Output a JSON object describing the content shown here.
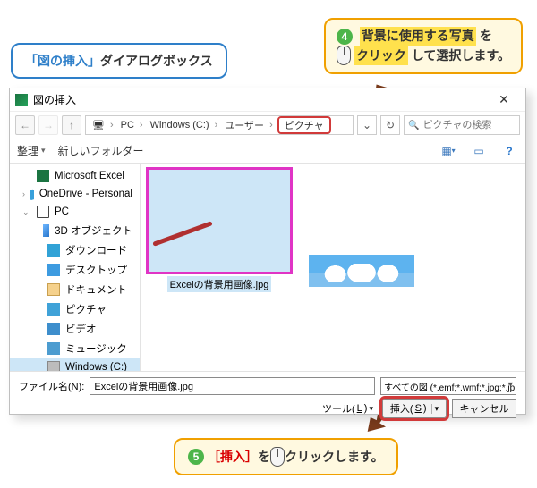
{
  "callouts": {
    "topLeft": {
      "blue": "「図の挿入」",
      "rest": "ダイアログボックス"
    },
    "topRight": {
      "step": "4",
      "line1a": "背景に使用する写真",
      "line1b": "を",
      "line2a": "クリック",
      "line2b": "して選択します。"
    },
    "bottom": {
      "step": "5",
      "hl": "［挿入］",
      "mid": " を ",
      "click": "クリック",
      "end": "します。"
    }
  },
  "dialog": {
    "title": "図の挿入",
    "breadcrumb": [
      "PC",
      "Windows (C:)",
      "ユーザー"
    ],
    "breadcrumbCurrent": "ピクチャ",
    "searchPlaceholder": "ピクチャの検索",
    "toolbar": {
      "organize": "整理",
      "newFolder": "新しいフォルダー"
    },
    "sidebar": [
      {
        "label": "Microsoft Excel",
        "ico": "ico-excel",
        "exp": " "
      },
      {
        "label": "OneDrive - Personal",
        "ico": "ico-cloud",
        "exp": "›"
      },
      {
        "label": "PC",
        "ico": "ico-pc",
        "exp": "⌄"
      },
      {
        "label": "3D オブジェクト",
        "ico": "ico-3d",
        "exp": " ",
        "indent": true
      },
      {
        "label": "ダウンロード",
        "ico": "ico-dl",
        "exp": " ",
        "indent": true
      },
      {
        "label": "デスクトップ",
        "ico": "ico-desk",
        "exp": " ",
        "indent": true
      },
      {
        "label": "ドキュメント",
        "ico": "ico-doc",
        "exp": " ",
        "indent": true
      },
      {
        "label": "ピクチャ",
        "ico": "ico-pic",
        "exp": " ",
        "indent": true
      },
      {
        "label": "ビデオ",
        "ico": "ico-vid",
        "exp": " ",
        "indent": true
      },
      {
        "label": "ミュージック",
        "ico": "ico-mus",
        "exp": " ",
        "indent": true
      },
      {
        "label": "Windows (C:)",
        "ico": "ico-disk",
        "exp": " ",
        "indent": true,
        "selected": true
      }
    ],
    "files": [
      {
        "name": "Excelの背景用画像.jpg",
        "selected": true
      }
    ],
    "footer": {
      "filenameLabelPre": "ファイル名(",
      "filenameLabelU": "N",
      "filenameLabelPost": "):",
      "filenameValue": "Excelの背景用画像.jpg",
      "filter": "すべての図 (*.emf;*.wmf;*.jpg;*.jp",
      "toolsLabel": "ツール(",
      "toolsU": "L",
      "toolsPost": ")",
      "insertPre": "挿入(",
      "insertU": "S",
      "insertPost": ")",
      "cancel": "キャンセル"
    }
  }
}
